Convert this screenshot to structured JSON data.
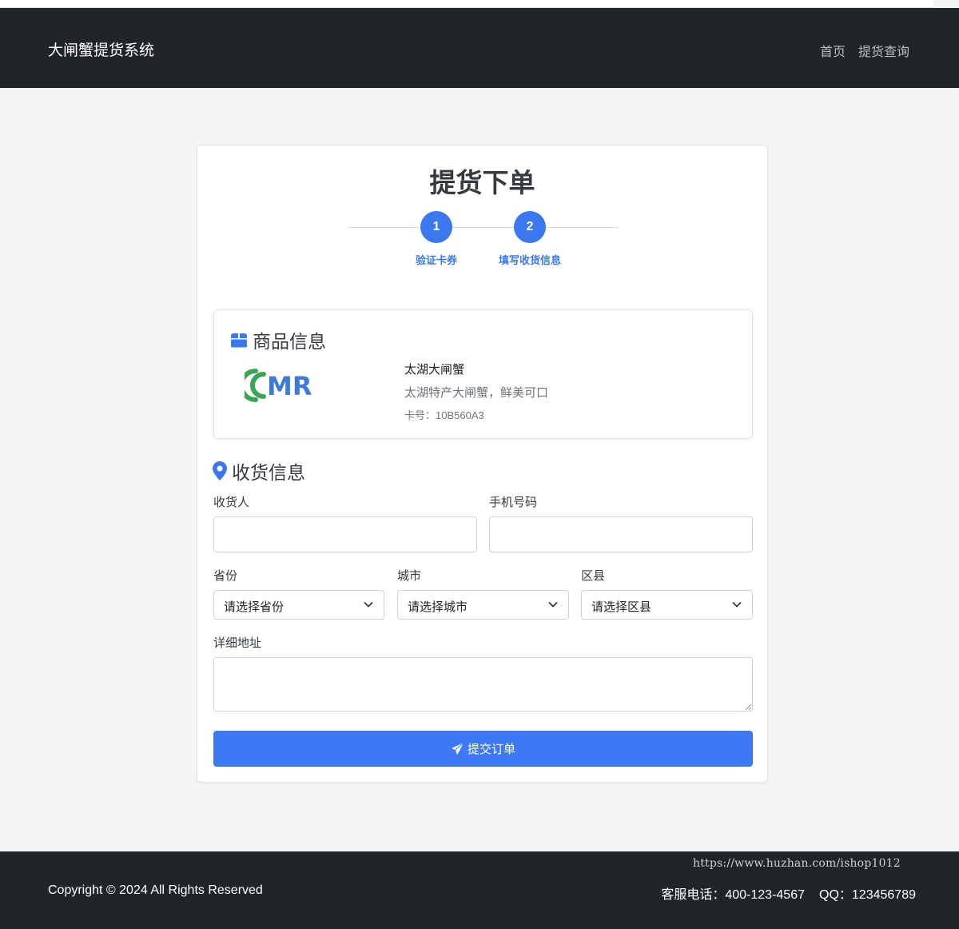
{
  "header": {
    "brand": "大闸蟹提货系统",
    "nav": [
      "首页",
      "提货查询"
    ]
  },
  "page": {
    "title": "提货下单",
    "steps": [
      {
        "number": "1",
        "label": "验证卡券"
      },
      {
        "number": "2",
        "label": "填写收货信息"
      }
    ]
  },
  "goods": {
    "heading": "商品信息",
    "logo_text": "MR",
    "name": "太湖大闸蟹",
    "description": "太湖特产大闸蟹，鲜美可口",
    "card_number": "卡号：10B560A3"
  },
  "shipping": {
    "heading": "收货信息",
    "receiver_label": "收货人",
    "receiver_value": "",
    "phone_label": "手机号码",
    "phone_value": "",
    "province_label": "省份",
    "province_value": "请选择省份",
    "city_label": "城市",
    "city_value": "请选择城市",
    "district_label": "区县",
    "district_value": "请选择区县",
    "address_label": "详细地址",
    "address_value": "",
    "submit_label": "提交订单"
  },
  "footer": {
    "watermark": "https://www.huzhan.com/ishop1012",
    "copyright": "Copyright © 2024 All Rights Reserved",
    "service_phone": "客服电话：400-123-4567",
    "qq": "QQ：123456789"
  },
  "colors": {
    "navbar": "#212529",
    "accent": "#3f78f5",
    "background": "#f4f5f7"
  },
  "icons": {
    "goods": "box-icon",
    "shipping": "map-marker-icon",
    "submit": "paper-plane-icon",
    "select": "chevron-down-icon"
  }
}
